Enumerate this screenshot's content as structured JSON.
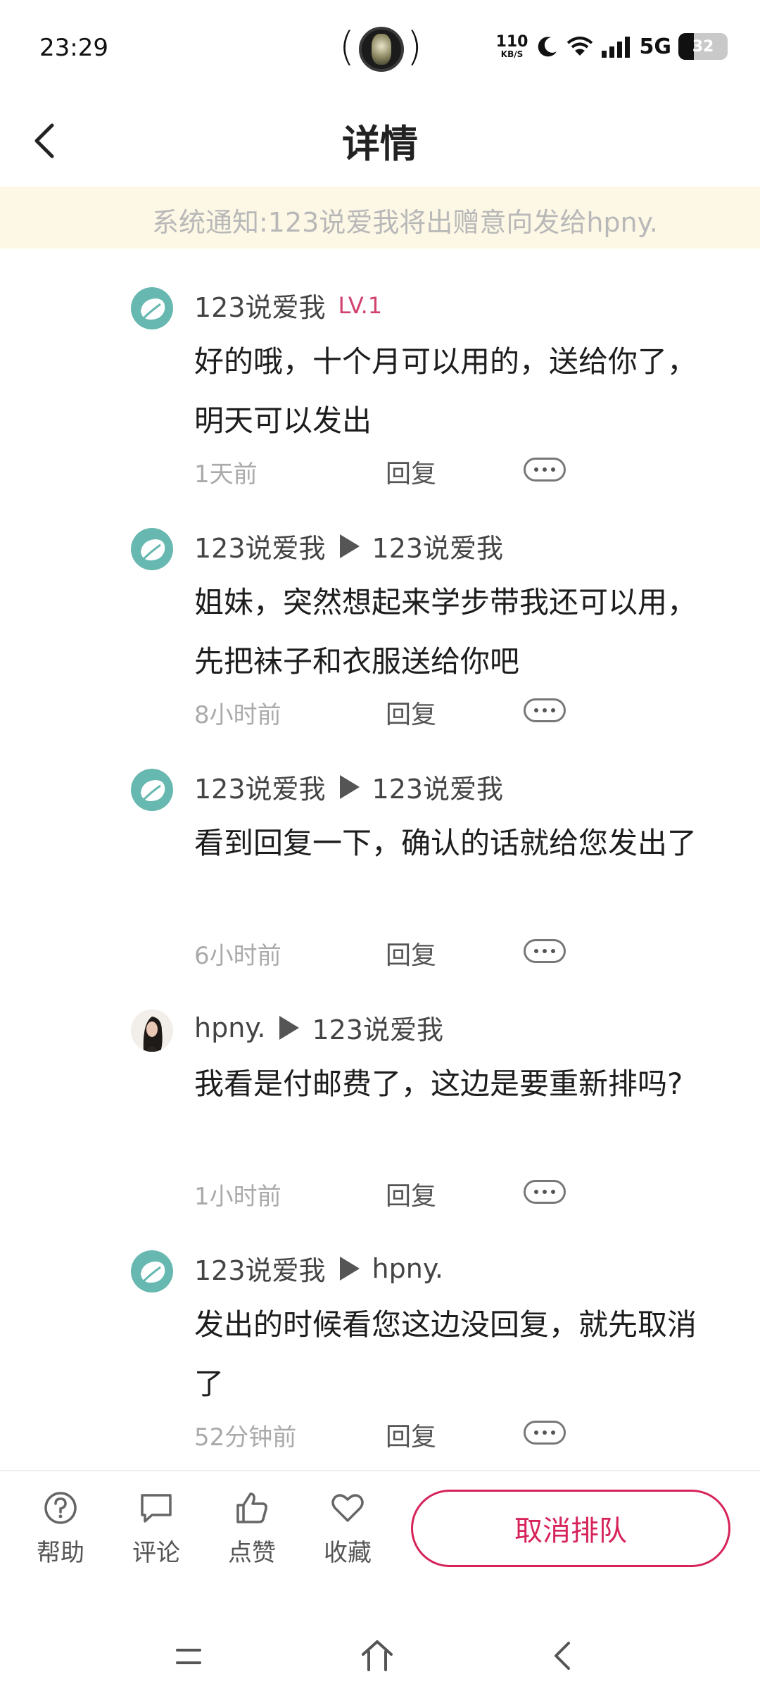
{
  "status_bar": {
    "time": "23:29",
    "speed_value": "110",
    "speed_unit": "KB/S",
    "network": "5G",
    "battery_level": "32",
    "battery_fraction": 0.32
  },
  "header": {
    "title": "详情",
    "back_icon": "chevron-left-icon"
  },
  "notice": {
    "text": "系统通知:123说爱我将出赠意向发给hpny."
  },
  "comments": [
    {
      "avatar": "leaf-avatar",
      "author": "123说爱我",
      "level": "LV.1",
      "reply_to": "",
      "text": "好的哦，十个月可以用的，送给你了，明天可以发出",
      "time": "1天前",
      "reply_label": "回复"
    },
    {
      "avatar": "leaf-avatar",
      "author": "123说爱我",
      "level": "",
      "reply_to": "123说爱我",
      "text": "姐妹，突然想起来学步带我还可以用，先把袜子和衣服送给你吧",
      "time": "8小时前",
      "reply_label": "回复"
    },
    {
      "avatar": "leaf-avatar",
      "author": "123说爱我",
      "level": "",
      "reply_to": "123说爱我",
      "text": "看到回复一下，确认的话就给您发出了",
      "time": "6小时前",
      "reply_label": "回复"
    },
    {
      "avatar": "photo-avatar",
      "author": "hpny.",
      "level": "",
      "reply_to": "123说爱我",
      "text": "我看是付邮费了，这边是要重新排吗?",
      "time": "1小时前",
      "reply_label": "回复"
    },
    {
      "avatar": "leaf-avatar",
      "author": "123说爱我",
      "level": "",
      "reply_to": "hpny.",
      "text": "发出的时候看您这边没回复，就先取消了",
      "time": "52分钟前",
      "reply_label": "回复"
    }
  ],
  "bottom_bar": {
    "help_label": "帮助",
    "comment_label": "评论",
    "like_label": "点赞",
    "favorite_label": "收藏",
    "cancel_queue_label": "取消排队"
  },
  "colors": {
    "accent": "#d6245a",
    "level": "#d2426e",
    "notice_bg": "#fdf8e6",
    "avatar_leaf": "#66b8b0"
  }
}
